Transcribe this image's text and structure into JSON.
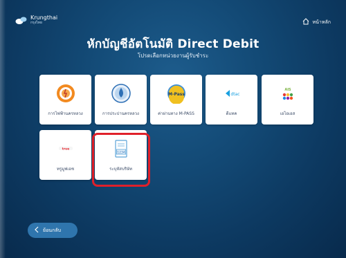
{
  "header": {
    "logo_name": "Krungthai",
    "logo_sub": "กรุงไทย",
    "home_label": "หน้าหลัก"
  },
  "title": "หักบัญชีอัตโนมัติ Direct Debit",
  "subtitle": "โปรดเลือกหน่วยงานผู้รับชำระ",
  "tiles": [
    {
      "label": "การไฟฟ้านครหลวง"
    },
    {
      "label": "การประปานครหลวง"
    },
    {
      "label": "ค่าผ่านทาง M-PASS"
    },
    {
      "label": "ดีแทค"
    },
    {
      "label": "เอไอเอส"
    },
    {
      "label": "ทรูมูฟเอช"
    },
    {
      "label": "ระบุหัสบริษัท"
    }
  ],
  "tile_icon_text": {
    "mpass": "M-Pass",
    "dtac": "dtac",
    "ais": "AIS",
    "true": "true",
    "code": "1234"
  },
  "back_label": "ย้อนกลับ",
  "colors": {
    "background": "#134a76",
    "highlight": "#e0202a",
    "tile_text": "#3a4a66"
  }
}
